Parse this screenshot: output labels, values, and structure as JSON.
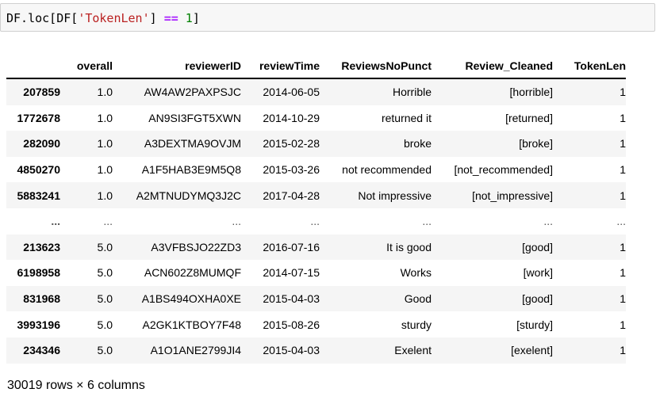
{
  "code": {
    "prefix": "DF.loc[DF[",
    "string": "'TokenLen'",
    "middle": "] ",
    "operator": "==",
    "space": " ",
    "number": "1",
    "suffix": "]"
  },
  "table": {
    "columns": [
      "",
      "overall",
      "reviewerID",
      "reviewTime",
      "ReviewsNoPunct",
      "Review_Cleaned",
      "TokenLen"
    ],
    "rows": [
      [
        "207859",
        "1.0",
        "AW4AW2PAXPSJC",
        "2014-06-05",
        "Horrible",
        "[horrible]",
        "1"
      ],
      [
        "1772678",
        "1.0",
        "AN9SI3FGT5XWN",
        "2014-10-29",
        "returned it",
        "[returned]",
        "1"
      ],
      [
        "282090",
        "1.0",
        "A3DEXTMA9OVJM",
        "2015-02-28",
        "broke",
        "[broke]",
        "1"
      ],
      [
        "4850270",
        "1.0",
        "A1F5HAB3E9M5Q8",
        "2015-03-26",
        "not recommended",
        "[not_recommended]",
        "1"
      ],
      [
        "5883241",
        "1.0",
        "A2MTNUDYMQ3J2C",
        "2017-04-28",
        "Not impressive",
        "[not_impressive]",
        "1"
      ],
      [
        "...",
        "...",
        "...",
        "...",
        "...",
        "...",
        "..."
      ],
      [
        "213623",
        "5.0",
        "A3VFBSJO22ZD3",
        "2016-07-16",
        "It is good",
        "[good]",
        "1"
      ],
      [
        "6198958",
        "5.0",
        "ACN602Z8MUMQF",
        "2014-07-15",
        "Works",
        "[work]",
        "1"
      ],
      [
        "831968",
        "5.0",
        "A1BS494OXHA0XE",
        "2015-04-03",
        "Good",
        "[good]",
        "1"
      ],
      [
        "3993196",
        "5.0",
        "A2GK1KTBOY7F48",
        "2015-08-26",
        "sturdy",
        "[sturdy]",
        "1"
      ],
      [
        "234346",
        "5.0",
        "A1O1ANE2799JI4",
        "2015-04-03",
        "Exelent",
        "[exelent]",
        "1"
      ]
    ]
  },
  "summary": "30019 rows × 6 columns"
}
